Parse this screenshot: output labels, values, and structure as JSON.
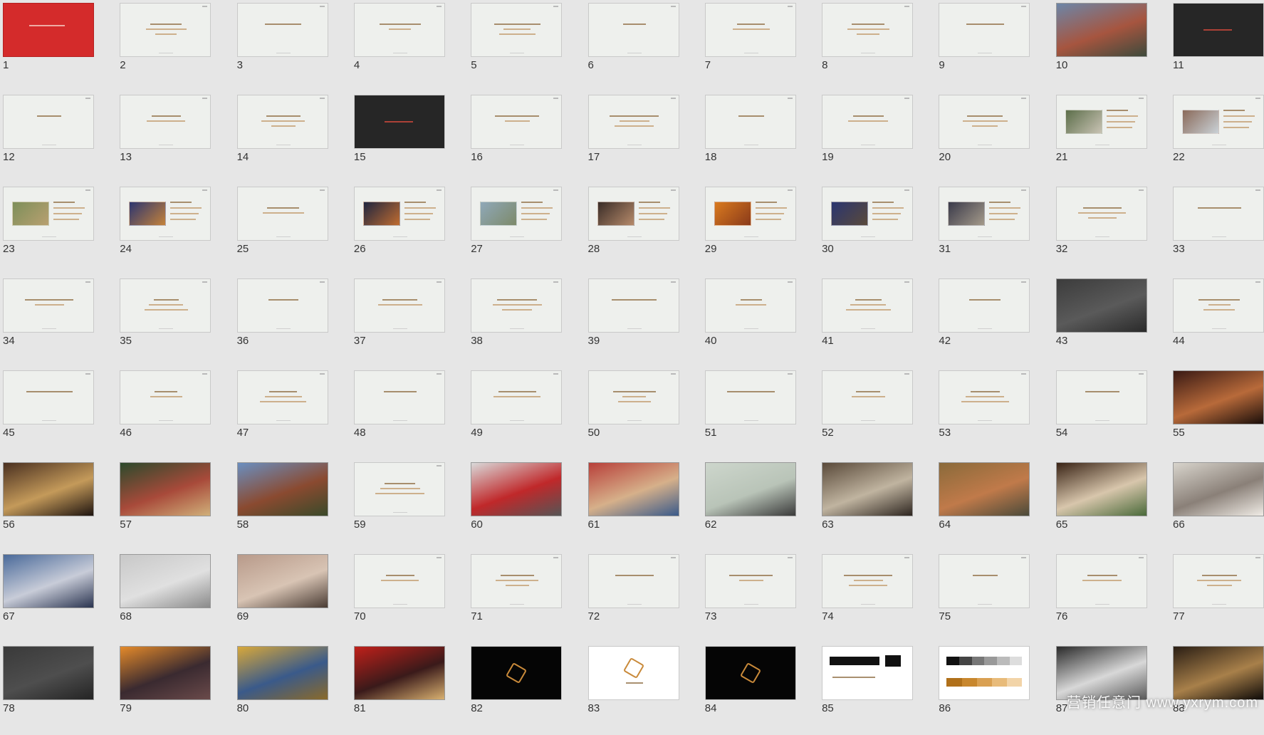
{
  "watermark": "营销任意门 www.yxrym.com",
  "slides": [
    {
      "n": "1",
      "kind": "red"
    },
    {
      "n": "2",
      "kind": "light"
    },
    {
      "n": "3",
      "kind": "light"
    },
    {
      "n": "4",
      "kind": "light"
    },
    {
      "n": "5",
      "kind": "light"
    },
    {
      "n": "6",
      "kind": "light"
    },
    {
      "n": "7",
      "kind": "light"
    },
    {
      "n": "8",
      "kind": "light"
    },
    {
      "n": "9",
      "kind": "light"
    },
    {
      "n": "10",
      "kind": "photo",
      "colors": [
        "#6c86a8",
        "#a6553f",
        "#3d4a3c"
      ]
    },
    {
      "n": "11",
      "kind": "dark"
    },
    {
      "n": "12",
      "kind": "light"
    },
    {
      "n": "13",
      "kind": "light"
    },
    {
      "n": "14",
      "kind": "light"
    },
    {
      "n": "15",
      "kind": "dark"
    },
    {
      "n": "16",
      "kind": "light"
    },
    {
      "n": "17",
      "kind": "light"
    },
    {
      "n": "18",
      "kind": "light"
    },
    {
      "n": "19",
      "kind": "light"
    },
    {
      "n": "20",
      "kind": "light"
    },
    {
      "n": "21",
      "kind": "lightpic",
      "colors": [
        "#5c6e4a",
        "#c9c3b4"
      ]
    },
    {
      "n": "22",
      "kind": "lightpic",
      "colors": [
        "#8a6a5a",
        "#c9d1d6"
      ]
    },
    {
      "n": "23",
      "kind": "lightpic",
      "colors": [
        "#7d8f5a",
        "#b8a070"
      ]
    },
    {
      "n": "24",
      "kind": "lightpic",
      "colors": [
        "#2c3570",
        "#c4823a"
      ]
    },
    {
      "n": "25",
      "kind": "light"
    },
    {
      "n": "26",
      "kind": "lightpic",
      "colors": [
        "#1e2540",
        "#c06c30"
      ]
    },
    {
      "n": "27",
      "kind": "lightpic",
      "colors": [
        "#8fa8b8",
        "#7d8a6a"
      ]
    },
    {
      "n": "28",
      "kind": "lightpic",
      "colors": [
        "#3a2d28",
        "#b68a6a"
      ]
    },
    {
      "n": "29",
      "kind": "lightpic",
      "colors": [
        "#d97a1f",
        "#8a3a1a"
      ]
    },
    {
      "n": "30",
      "kind": "lightpic",
      "colors": [
        "#2a3570",
        "#5a4a3a"
      ]
    },
    {
      "n": "31",
      "kind": "lightpic",
      "colors": [
        "#3a3a4a",
        "#a49a8a"
      ]
    },
    {
      "n": "32",
      "kind": "light"
    },
    {
      "n": "33",
      "kind": "light"
    },
    {
      "n": "34",
      "kind": "light"
    },
    {
      "n": "35",
      "kind": "light"
    },
    {
      "n": "36",
      "kind": "light"
    },
    {
      "n": "37",
      "kind": "light"
    },
    {
      "n": "38",
      "kind": "light"
    },
    {
      "n": "39",
      "kind": "light"
    },
    {
      "n": "40",
      "kind": "light"
    },
    {
      "n": "41",
      "kind": "light"
    },
    {
      "n": "42",
      "kind": "light"
    },
    {
      "n": "43",
      "kind": "photo",
      "colors": [
        "#3c3c3c",
        "#5a5a5a",
        "#2a2a2a"
      ]
    },
    {
      "n": "44",
      "kind": "light"
    },
    {
      "n": "45",
      "kind": "light"
    },
    {
      "n": "46",
      "kind": "light"
    },
    {
      "n": "47",
      "kind": "light"
    },
    {
      "n": "48",
      "kind": "light"
    },
    {
      "n": "49",
      "kind": "light"
    },
    {
      "n": "50",
      "kind": "light"
    },
    {
      "n": "51",
      "kind": "light"
    },
    {
      "n": "52",
      "kind": "light"
    },
    {
      "n": "53",
      "kind": "light"
    },
    {
      "n": "54",
      "kind": "light"
    },
    {
      "n": "55",
      "kind": "photo",
      "colors": [
        "#3a1a14",
        "#b86a3a",
        "#1a0e0a"
      ]
    },
    {
      "n": "56",
      "kind": "photo",
      "colors": [
        "#4a3020",
        "#c49a5a",
        "#1e1410"
      ]
    },
    {
      "n": "57",
      "kind": "photo",
      "colors": [
        "#2c4a2c",
        "#a84a3a",
        "#d0b07a"
      ]
    },
    {
      "n": "58",
      "kind": "photo",
      "colors": [
        "#6a8fc0",
        "#8a4a30",
        "#3a4a2a"
      ]
    },
    {
      "n": "59",
      "kind": "light"
    },
    {
      "n": "60",
      "kind": "photo",
      "colors": [
        "#d9d9d9",
        "#c0282a",
        "#555555"
      ]
    },
    {
      "n": "61",
      "kind": "photo",
      "colors": [
        "#b8403a",
        "#d6b08a",
        "#3a5a8a"
      ]
    },
    {
      "n": "62",
      "kind": "photo",
      "colors": [
        "#cdd6cc",
        "#b9c4b8",
        "#3a3a3a"
      ]
    },
    {
      "n": "63",
      "kind": "photo",
      "colors": [
        "#5a4a3a",
        "#c0b4a0",
        "#2e2620"
      ]
    },
    {
      "n": "64",
      "kind": "photo",
      "colors": [
        "#8a6a3a",
        "#c07a4a",
        "#4a4a3a"
      ]
    },
    {
      "n": "65",
      "kind": "photo",
      "colors": [
        "#3a2416",
        "#d8c6ac",
        "#4a6a3a"
      ]
    },
    {
      "n": "66",
      "kind": "photo",
      "colors": [
        "#d8d4cc",
        "#8a8078",
        "#f0ece6"
      ]
    },
    {
      "n": "67",
      "kind": "photo",
      "colors": [
        "#4a6a9a",
        "#c8ccd8",
        "#2a3450"
      ]
    },
    {
      "n": "68",
      "kind": "photo",
      "colors": [
        "#c8c8c8",
        "#e0e0e0",
        "#8a8a8a"
      ]
    },
    {
      "n": "69",
      "kind": "photo",
      "colors": [
        "#b89a8a",
        "#d8c4b4",
        "#4a3c34"
      ]
    },
    {
      "n": "70",
      "kind": "light"
    },
    {
      "n": "71",
      "kind": "light"
    },
    {
      "n": "72",
      "kind": "light"
    },
    {
      "n": "73",
      "kind": "light"
    },
    {
      "n": "74",
      "kind": "light"
    },
    {
      "n": "75",
      "kind": "light"
    },
    {
      "n": "76",
      "kind": "light"
    },
    {
      "n": "77",
      "kind": "light"
    },
    {
      "n": "78",
      "kind": "photo",
      "colors": [
        "#3a3a3a",
        "#4e4e4e",
        "#242424"
      ]
    },
    {
      "n": "79",
      "kind": "photo",
      "colors": [
        "#e48a2a",
        "#3a2a30",
        "#6a4a4a"
      ]
    },
    {
      "n": "80",
      "kind": "photo",
      "colors": [
        "#d8a83a",
        "#3a5a8a",
        "#8a6a2a"
      ]
    },
    {
      "n": "81",
      "kind": "photo",
      "colors": [
        "#c0201a",
        "#3a1a1a",
        "#d8b070"
      ]
    },
    {
      "n": "82",
      "kind": "black"
    },
    {
      "n": "83",
      "kind": "white"
    },
    {
      "n": "84",
      "kind": "black"
    },
    {
      "n": "85",
      "kind": "white2"
    },
    {
      "n": "86",
      "kind": "swatch"
    },
    {
      "n": "87",
      "kind": "photo",
      "colors": [
        "#2a2a2a",
        "#d8d8d8",
        "#5a5a5a"
      ]
    },
    {
      "n": "88",
      "kind": "photo",
      "colors": [
        "#2a1e14",
        "#a8804a",
        "#0e0a08"
      ]
    }
  ]
}
